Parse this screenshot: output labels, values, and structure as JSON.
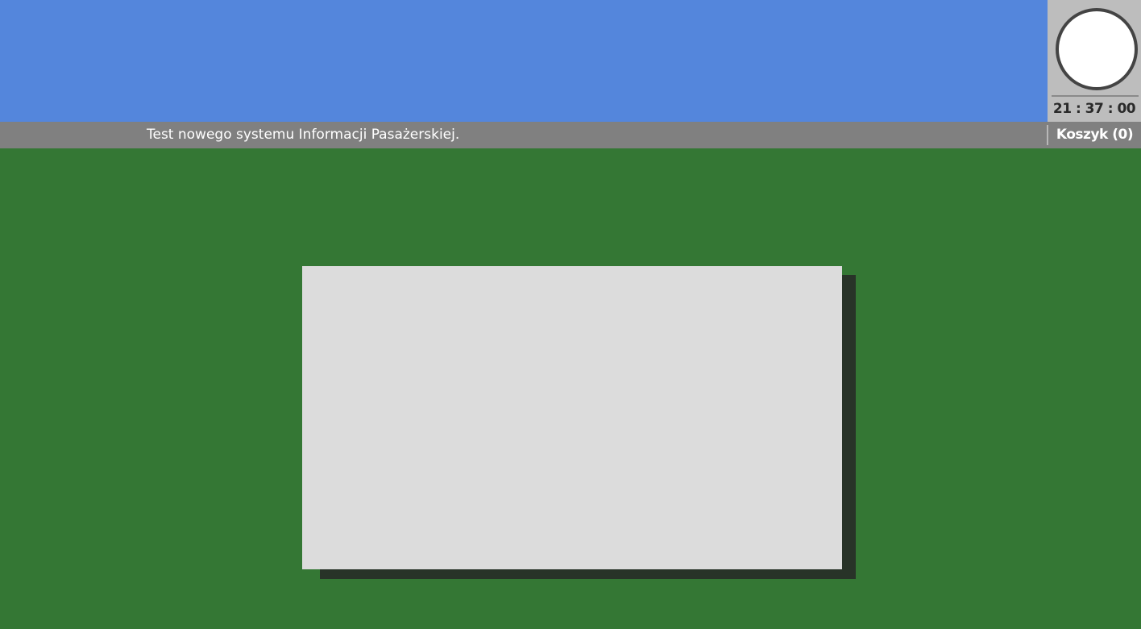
{
  "clock": {
    "time": "21 : 37 : 00"
  },
  "ticker": {
    "message": "Test nowego systemu Informacji Pasażerskiej."
  },
  "cart": {
    "label": "Koszyk (0)"
  },
  "colors": {
    "header": "#5486dc",
    "background": "#347734",
    "ticker_bar": "#808080",
    "clock_panel": "#bdbdbd",
    "dialog": "#dcdcdc",
    "dialog_shadow": "#283328"
  }
}
